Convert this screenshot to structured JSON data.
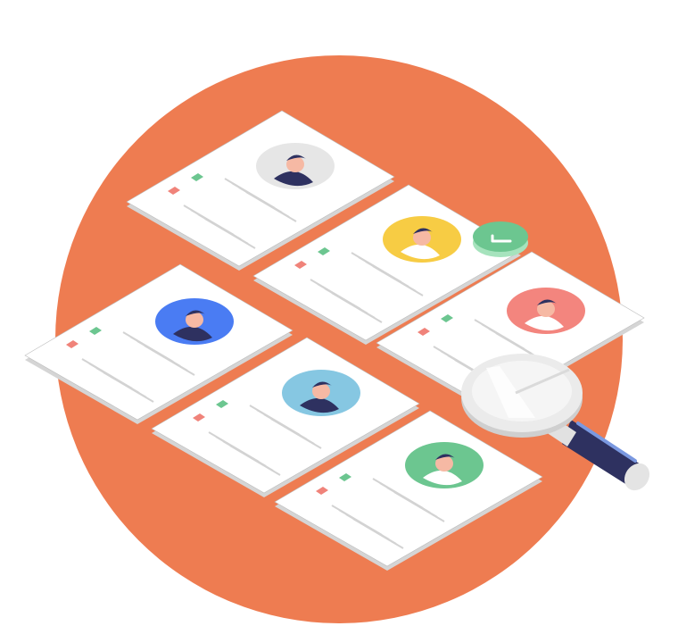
{
  "illustration": {
    "subject": "resume-candidate-search",
    "colors": {
      "backdrop": "#EE7C51",
      "card": "#FFFFFF",
      "card_edge": "#D5D5D5",
      "line": "#D3D3D3",
      "tag_red": "#F0837A",
      "tag_green": "#6CC690",
      "check_badge": "#6CC690",
      "magnifier_rim": "#E3E3E3",
      "magnifier_handle": "#2E3160"
    },
    "cards": [
      {
        "name": "card-top",
        "avatar_color": "#E6E6E6",
        "icon": "woman-avatar-icon"
      },
      {
        "name": "card-upper-middle",
        "avatar_color": "#F7CC44",
        "icon": "man-avatar-icon"
      },
      {
        "name": "card-left",
        "avatar_color": "#4A7CF3",
        "icon": "woman-avatar-icon"
      },
      {
        "name": "card-right",
        "avatar_color": "#F3857E",
        "icon": "man-avatar-icon"
      },
      {
        "name": "card-center",
        "avatar_color": "#86C7E2",
        "icon": "woman-glasses-avatar-icon"
      },
      {
        "name": "card-bottom",
        "avatar_color": "#6CC690",
        "icon": "man-avatar-icon"
      }
    ],
    "badge_icon": "checkmark-icon",
    "tool_icon": "magnifying-glass-icon"
  }
}
